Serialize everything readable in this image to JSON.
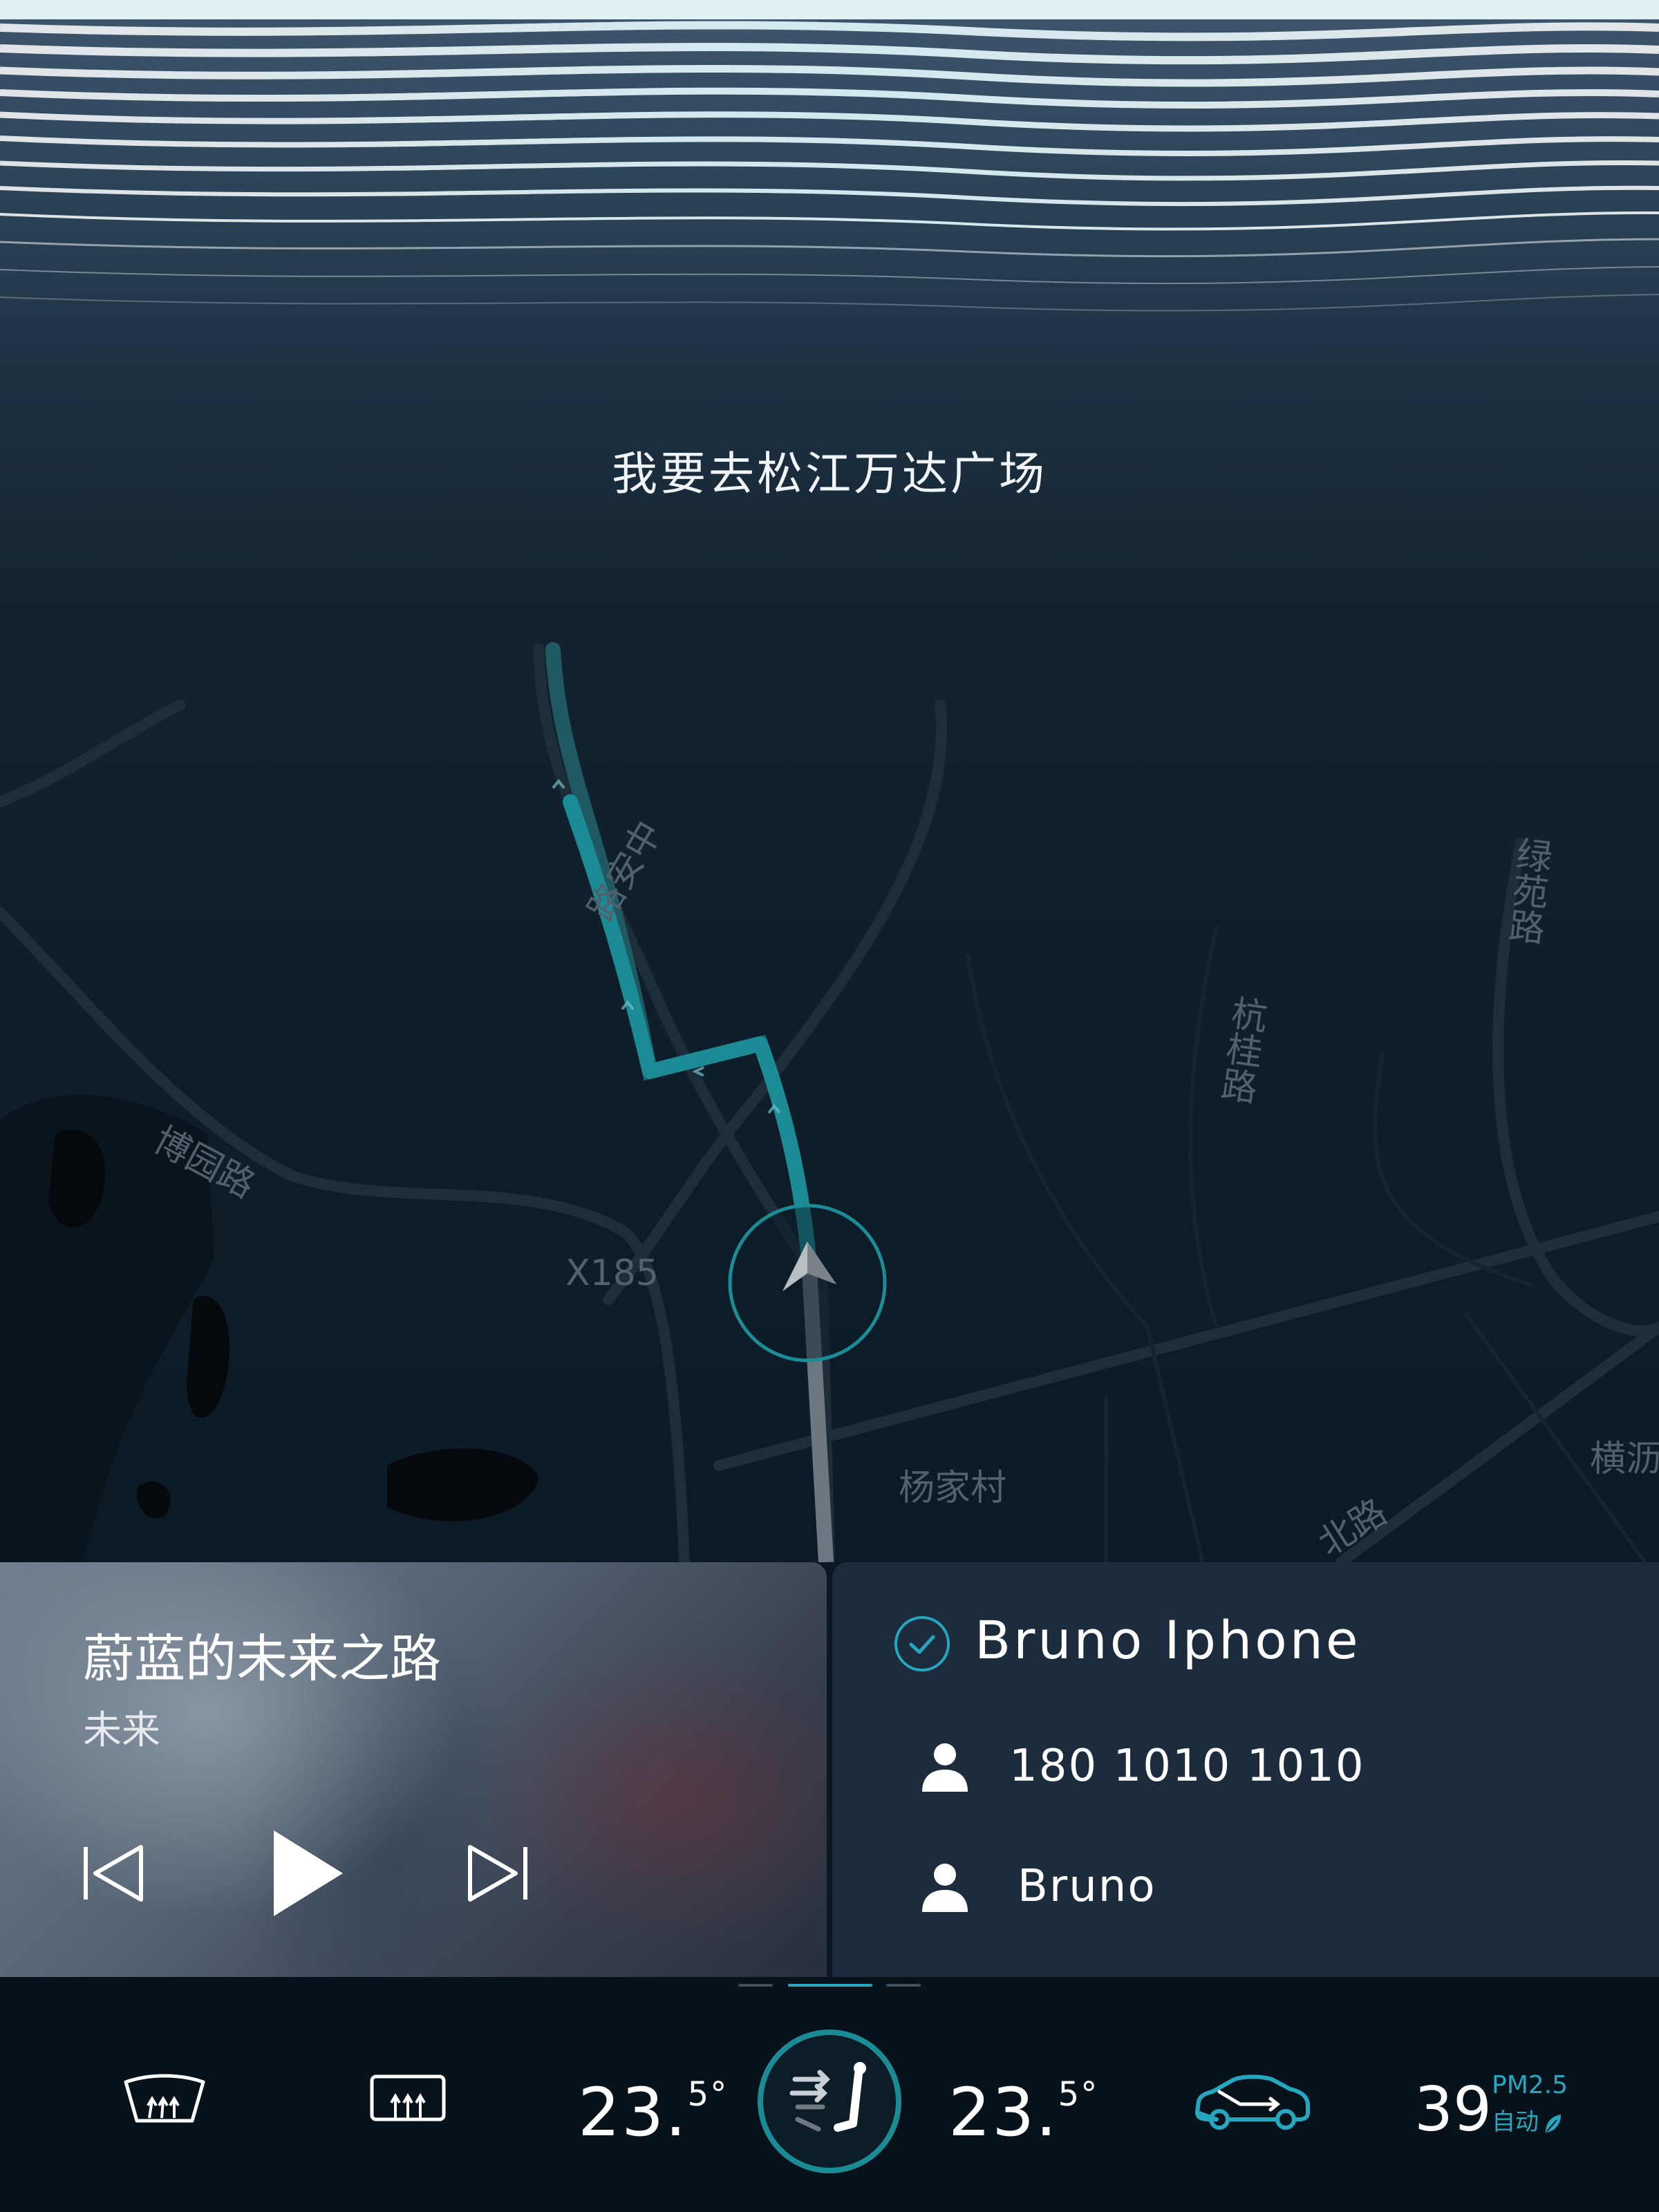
{
  "voice": {
    "text": "我要去松江万达广场"
  },
  "map": {
    "labels": {
      "boyuan_road": "博园路",
      "road_x185": "X185",
      "yangjia_village": "杨家村",
      "hanggui_road": "杭桂路",
      "lvyuan_road": "绿苑路",
      "north_road": "北路",
      "heng": "横沥",
      "route_road": "路安中"
    }
  },
  "music": {
    "title": "蔚蓝的未来之路",
    "artist": "未来"
  },
  "phone": {
    "device_name": "Bruno Iphone",
    "contacts": [
      {
        "text": "180 1010 1010"
      },
      {
        "text": "Bruno"
      }
    ]
  },
  "climate": {
    "left_temp_int": "23.",
    "left_temp_dec": "5°",
    "right_temp_int": "23.",
    "right_temp_dec": "5°",
    "air_value": "39",
    "air_label": "PM2.5",
    "air_mode": "自动",
    "accent_color": "#25a7c0"
  }
}
